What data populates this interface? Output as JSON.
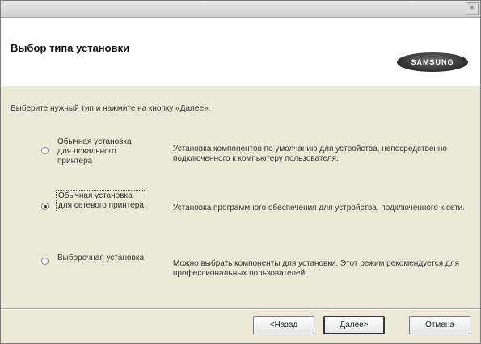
{
  "window": {
    "close_glyph": "×"
  },
  "header": {
    "title": "Выбор типа установки",
    "logo_text": "SAMSUNG"
  },
  "instruction": "Выберите нужный тип и нажмите на кнопку «Далее».",
  "options": [
    {
      "label": "Обычная установка для локального принтера",
      "description": "Установка компонентов по умолчанию для устройства, непосредственно подключенного к компьютеру пользователя.",
      "checked": false
    },
    {
      "label": "Обычная установка для сетевого принтера",
      "description": "Установка программного обеспечения для устройства, подключенного к сети.",
      "checked": true
    },
    {
      "label": "Выборочная установка",
      "description": "Можно выбрать компоненты для установки. Этот режим рекомендуется для профессиональных пользователей.",
      "checked": false
    }
  ],
  "buttons": {
    "back": "<Назад",
    "next": "Далее>",
    "cancel": "Отмена"
  },
  "colors": {
    "dialog_bg": "#ece9d8",
    "header_bg": "#ffffff"
  }
}
